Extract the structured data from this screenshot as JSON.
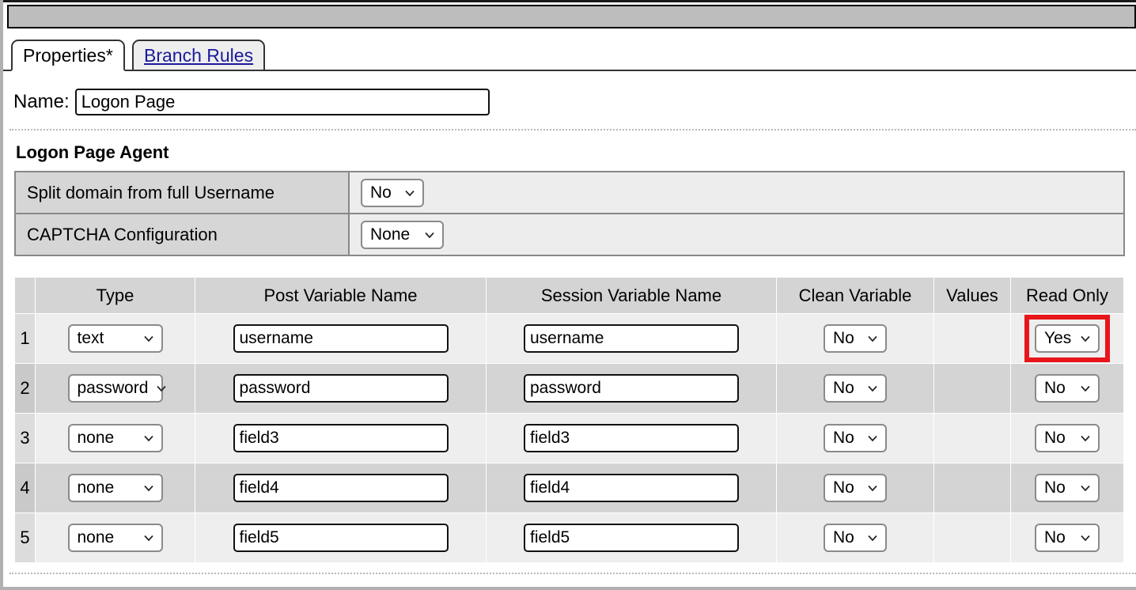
{
  "window": {
    "toolbar_label": ""
  },
  "tabs": [
    {
      "label": "Properties*",
      "active": true
    },
    {
      "label": "Branch Rules",
      "active": false
    }
  ],
  "name_field": {
    "label": "Name:",
    "value": "Logon Page",
    "placeholder": ""
  },
  "agent_section": {
    "title": "Logon Page Agent",
    "rows": [
      {
        "label": "Split domain from full Username",
        "value": "No"
      },
      {
        "label": "CAPTCHA Configuration",
        "value": "None"
      }
    ]
  },
  "grid": {
    "headers": {
      "num": "",
      "type": "Type",
      "post": "Post Variable Name",
      "session": "Session Variable Name",
      "clean": "Clean Variable",
      "values": "Values",
      "readonly": "Read Only"
    },
    "rows": [
      {
        "num": "1",
        "type": "text",
        "post": "username",
        "session": "username",
        "clean": "No",
        "values": "",
        "readonly": "Yes",
        "highlighted": true
      },
      {
        "num": "2",
        "type": "password",
        "post": "password",
        "session": "password",
        "clean": "No",
        "values": "",
        "readonly": "No",
        "highlighted": false
      },
      {
        "num": "3",
        "type": "none",
        "post": "field3",
        "session": "field3",
        "clean": "No",
        "values": "",
        "readonly": "No",
        "highlighted": false
      },
      {
        "num": "4",
        "type": "none",
        "post": "field4",
        "session": "field4",
        "clean": "No",
        "values": "",
        "readonly": "No",
        "highlighted": false
      },
      {
        "num": "5",
        "type": "none",
        "post": "field5",
        "session": "field5",
        "clean": "No",
        "values": "",
        "readonly": "No",
        "highlighted": false
      }
    ]
  },
  "colors": {
    "highlight": "#e8151a",
    "tab_link": "#1a1a9c",
    "header_bg": "#d4d4d4",
    "toolbar_bg": "#bdbdbd"
  },
  "icons": {
    "chevron": "chevron-down-icon"
  }
}
